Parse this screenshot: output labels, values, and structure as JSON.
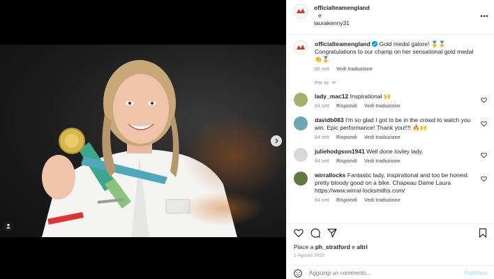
{
  "header": {
    "account1": "officialteamengland",
    "connector": "e",
    "account2": "laurakenny31",
    "more_icon": "more-horizontal-icon"
  },
  "caption": {
    "username": "officialteamengland",
    "verified_icon": "verified-badge-icon",
    "text": "Gold medal galore! 🥇🥇 Congratulations to our champ on her sensational gold medal 👏🥇",
    "time": "85 sett",
    "translate": "Vedi traduzione"
  },
  "filter_label": "Per te",
  "comments": [
    {
      "username": "lady_mac12",
      "text": "Inspirational 🙌",
      "time": "84 sett",
      "reply": "Rispondi",
      "translate": "Vedi traduzione",
      "avatar_color": "#a7b06a"
    },
    {
      "username": "davidb083",
      "text": "I'm so glad I got to be in the crowd to watch you win. Epic performance! Thank you!!!! 🔥🙌",
      "time": "84 sett",
      "reply": "Rispondi",
      "translate": "Vedi traduzione",
      "avatar_color": "#6aa7b0"
    },
    {
      "username": "juliehodgson1941",
      "text": "Well done lovley lady.",
      "time": "84 sett",
      "reply": "Rispondi",
      "translate": "Vedi traduzione",
      "avatar_color": "#d8d8d8"
    },
    {
      "username": "wirrallocks",
      "text": "Fantastic lady, inspirational and too be honest pretty bloody good on a bike. Chapeau Dame Laura https://www.wirral-locksmiths.com/",
      "time": "84 sett",
      "reply": "Rispondi",
      "translate": "Vedi traduzione",
      "avatar_color": "#5f7c3e"
    }
  ],
  "likes": {
    "prefix": "Piace a",
    "user": "ph_stratford",
    "conj": "e",
    "others": "altri"
  },
  "post_date": "1 Agosto 2022",
  "compose": {
    "placeholder": "Aggiungi un commento...",
    "publish": "Pubblica",
    "emoji_icon": "emoji-smile-icon"
  },
  "colors": {
    "verified": "#0095f6",
    "publish_disabled": "#b2dffc",
    "muted": "#8e8e8e"
  }
}
